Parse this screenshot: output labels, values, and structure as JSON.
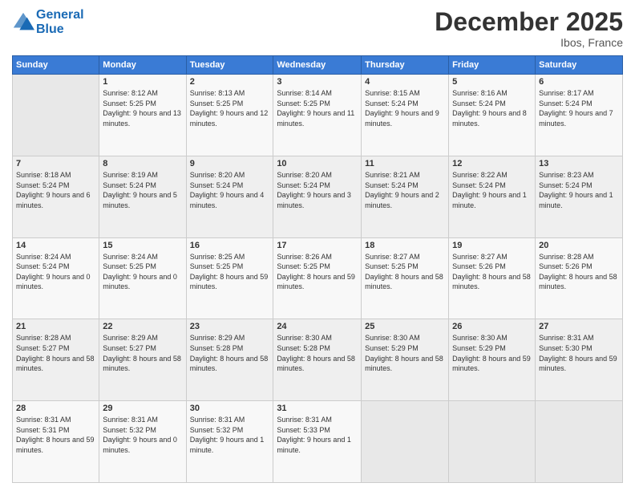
{
  "logo": {
    "line1": "General",
    "line2": "Blue"
  },
  "title": "December 2025",
  "location": "Ibos, France",
  "days_header": [
    "Sunday",
    "Monday",
    "Tuesday",
    "Wednesday",
    "Thursday",
    "Friday",
    "Saturday"
  ],
  "weeks": [
    [
      {
        "day": "",
        "sunrise": "",
        "sunset": "",
        "daylight": ""
      },
      {
        "day": "1",
        "sunrise": "8:12 AM",
        "sunset": "5:25 PM",
        "daylight": "9 hours and 13 minutes."
      },
      {
        "day": "2",
        "sunrise": "8:13 AM",
        "sunset": "5:25 PM",
        "daylight": "9 hours and 12 minutes."
      },
      {
        "day": "3",
        "sunrise": "8:14 AM",
        "sunset": "5:25 PM",
        "daylight": "9 hours and 11 minutes."
      },
      {
        "day": "4",
        "sunrise": "8:15 AM",
        "sunset": "5:24 PM",
        "daylight": "9 hours and 9 minutes."
      },
      {
        "day": "5",
        "sunrise": "8:16 AM",
        "sunset": "5:24 PM",
        "daylight": "9 hours and 8 minutes."
      },
      {
        "day": "6",
        "sunrise": "8:17 AM",
        "sunset": "5:24 PM",
        "daylight": "9 hours and 7 minutes."
      }
    ],
    [
      {
        "day": "7",
        "sunrise": "8:18 AM",
        "sunset": "5:24 PM",
        "daylight": "9 hours and 6 minutes."
      },
      {
        "day": "8",
        "sunrise": "8:19 AM",
        "sunset": "5:24 PM",
        "daylight": "9 hours and 5 minutes."
      },
      {
        "day": "9",
        "sunrise": "8:20 AM",
        "sunset": "5:24 PM",
        "daylight": "9 hours and 4 minutes."
      },
      {
        "day": "10",
        "sunrise": "8:20 AM",
        "sunset": "5:24 PM",
        "daylight": "9 hours and 3 minutes."
      },
      {
        "day": "11",
        "sunrise": "8:21 AM",
        "sunset": "5:24 PM",
        "daylight": "9 hours and 2 minutes."
      },
      {
        "day": "12",
        "sunrise": "8:22 AM",
        "sunset": "5:24 PM",
        "daylight": "9 hours and 1 minute."
      },
      {
        "day": "13",
        "sunrise": "8:23 AM",
        "sunset": "5:24 PM",
        "daylight": "9 hours and 1 minute."
      }
    ],
    [
      {
        "day": "14",
        "sunrise": "8:24 AM",
        "sunset": "5:24 PM",
        "daylight": "9 hours and 0 minutes."
      },
      {
        "day": "15",
        "sunrise": "8:24 AM",
        "sunset": "5:25 PM",
        "daylight": "9 hours and 0 minutes."
      },
      {
        "day": "16",
        "sunrise": "8:25 AM",
        "sunset": "5:25 PM",
        "daylight": "8 hours and 59 minutes."
      },
      {
        "day": "17",
        "sunrise": "8:26 AM",
        "sunset": "5:25 PM",
        "daylight": "8 hours and 59 minutes."
      },
      {
        "day": "18",
        "sunrise": "8:27 AM",
        "sunset": "5:25 PM",
        "daylight": "8 hours and 58 minutes."
      },
      {
        "day": "19",
        "sunrise": "8:27 AM",
        "sunset": "5:26 PM",
        "daylight": "8 hours and 58 minutes."
      },
      {
        "day": "20",
        "sunrise": "8:28 AM",
        "sunset": "5:26 PM",
        "daylight": "8 hours and 58 minutes."
      }
    ],
    [
      {
        "day": "21",
        "sunrise": "8:28 AM",
        "sunset": "5:27 PM",
        "daylight": "8 hours and 58 minutes."
      },
      {
        "day": "22",
        "sunrise": "8:29 AM",
        "sunset": "5:27 PM",
        "daylight": "8 hours and 58 minutes."
      },
      {
        "day": "23",
        "sunrise": "8:29 AM",
        "sunset": "5:28 PM",
        "daylight": "8 hours and 58 minutes."
      },
      {
        "day": "24",
        "sunrise": "8:30 AM",
        "sunset": "5:28 PM",
        "daylight": "8 hours and 58 minutes."
      },
      {
        "day": "25",
        "sunrise": "8:30 AM",
        "sunset": "5:29 PM",
        "daylight": "8 hours and 58 minutes."
      },
      {
        "day": "26",
        "sunrise": "8:30 AM",
        "sunset": "5:29 PM",
        "daylight": "8 hours and 59 minutes."
      },
      {
        "day": "27",
        "sunrise": "8:31 AM",
        "sunset": "5:30 PM",
        "daylight": "8 hours and 59 minutes."
      }
    ],
    [
      {
        "day": "28",
        "sunrise": "8:31 AM",
        "sunset": "5:31 PM",
        "daylight": "8 hours and 59 minutes."
      },
      {
        "day": "29",
        "sunrise": "8:31 AM",
        "sunset": "5:32 PM",
        "daylight": "9 hours and 0 minutes."
      },
      {
        "day": "30",
        "sunrise": "8:31 AM",
        "sunset": "5:32 PM",
        "daylight": "9 hours and 1 minute."
      },
      {
        "day": "31",
        "sunrise": "8:31 AM",
        "sunset": "5:33 PM",
        "daylight": "9 hours and 1 minute."
      },
      {
        "day": "",
        "sunrise": "",
        "sunset": "",
        "daylight": ""
      },
      {
        "day": "",
        "sunrise": "",
        "sunset": "",
        "daylight": ""
      },
      {
        "day": "",
        "sunrise": "",
        "sunset": "",
        "daylight": ""
      }
    ]
  ],
  "labels": {
    "sunrise": "Sunrise:",
    "sunset": "Sunset:",
    "daylight": "Daylight:"
  }
}
